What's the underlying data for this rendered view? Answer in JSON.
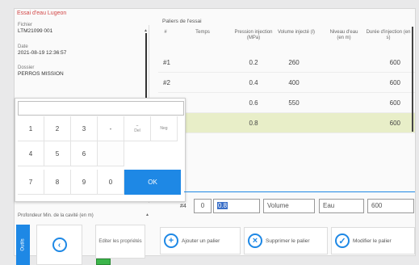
{
  "window": {
    "title": "Essai d'eau Lugeon"
  },
  "left_panel": {
    "fichier": {
      "label": "Fichier",
      "value": "LTM21099 001"
    },
    "date": {
      "label": "Date",
      "value": "2021-08-19 12:36:57"
    },
    "dossier": {
      "label": "Dossier",
      "value": "PERROS MISSION"
    },
    "preference_label": "Profondeur Min. de la cavité (en m)",
    "outils_label": "Outils",
    "edit_label": "Editer les propriétés"
  },
  "keypad": {
    "keys": [
      "1",
      "2",
      "3",
      "-",
      "4",
      "5",
      "6",
      "7",
      "8",
      "9",
      "0"
    ],
    "del_label": "Del",
    "neg_label": "Neg",
    "ok_label": "OK"
  },
  "table": {
    "title": "Paliers de l'essai",
    "headers": [
      "#",
      "Temps",
      "Pression injection (MPa)",
      "Volume injecté (l)",
      "Niveau d'eau (en m)",
      "Durée d'injection (en s)"
    ],
    "rows": [
      {
        "num": "#1",
        "pression": "0.2",
        "volume": "260",
        "duree": "600"
      },
      {
        "num": "#2",
        "pression": "0.4",
        "volume": "400",
        "duree": "600"
      },
      {
        "num": "#3",
        "pression": "0.6",
        "volume": "550",
        "duree": "600"
      },
      {
        "num": "#4",
        "pression": "0.8",
        "volume": "",
        "duree": "600"
      }
    ]
  },
  "input_row": {
    "num": "#4",
    "temps": "0",
    "pression": "0.8",
    "volume_placeholder": "Volume",
    "eau_placeholder": "Eau",
    "duree": "600"
  },
  "actions": {
    "add": "Ajouter un palier",
    "delete": "Supprimer le palier",
    "modify": "Modifier le palier"
  },
  "colors": {
    "accent": "#1e88e5",
    "selected_row": "#e8eec8",
    "title_red": "#d24747"
  }
}
